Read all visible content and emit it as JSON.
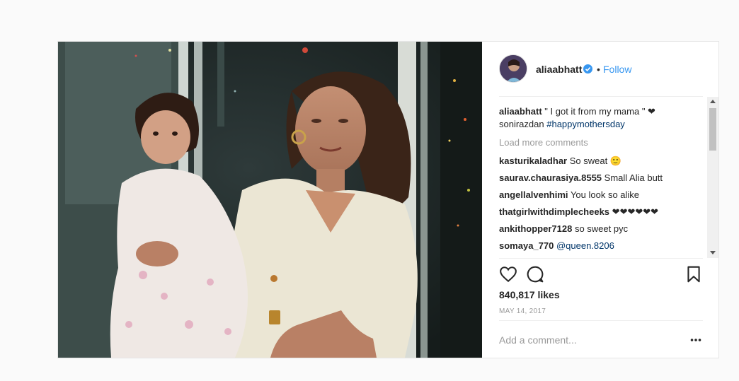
{
  "post": {
    "username": "aliaabhatt",
    "follow_label": "Follow",
    "separator": "•",
    "caption": {
      "username": "aliaabhatt",
      "text": " \" I got it from my mama \" ❤",
      "line2_mention": "sonirazdan",
      "line2_hashtag": "#happymothersday"
    },
    "load_more_label": "Load more comments",
    "comments": [
      {
        "username": "kasturikaladhar",
        "text": "So sweat 🙂"
      },
      {
        "username": "saurav.chaurasiya.8555",
        "text": "Small Alia butt"
      },
      {
        "username": "angellalvenhimi",
        "text": "You look so alike"
      },
      {
        "username": "thatgirlwithdimplecheeks",
        "text": "❤❤❤❤❤❤"
      },
      {
        "username": "ankithopper7128",
        "text": "so sweet pyc"
      },
      {
        "username": "somaya_770",
        "text": "@queen.8206"
      }
    ],
    "likes": "840,817 likes",
    "date": "MAY 14, 2017",
    "add_comment_placeholder": "Add a comment...",
    "icons": {
      "like": "heart-icon",
      "comment": "comment-bubble-icon",
      "save": "bookmark-icon",
      "verified": "verified-badge-icon",
      "more": "more-options-icon"
    },
    "colors": {
      "link": "#3897f0",
      "mention": "#003569",
      "muted": "#999999",
      "text": "#262626"
    }
  }
}
